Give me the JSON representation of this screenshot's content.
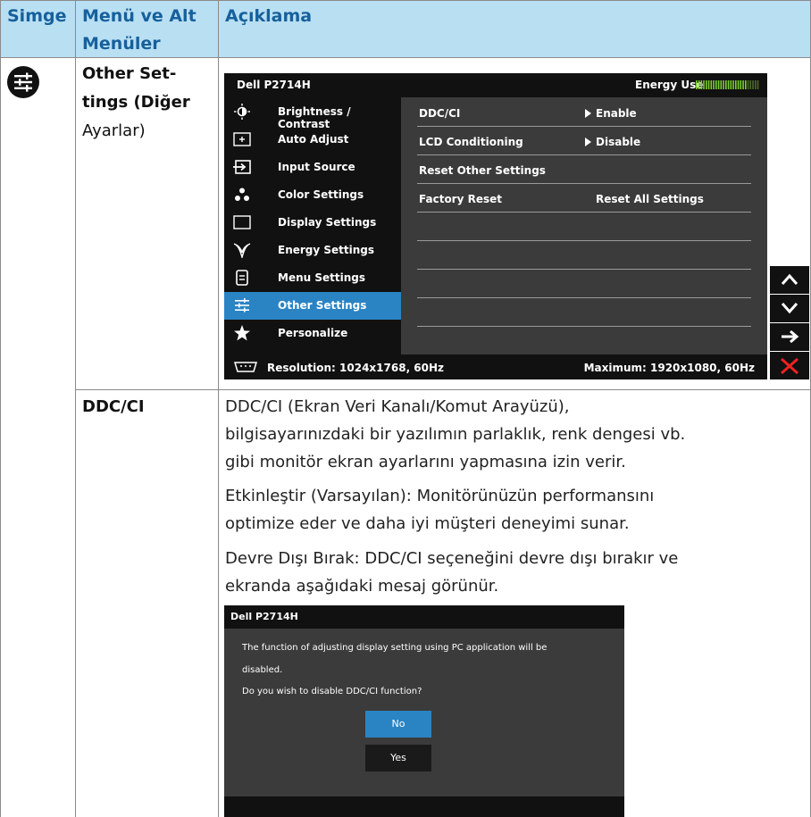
{
  "table": {
    "headers": [
      "Simge",
      "Menü ve Alt",
      "Menüler",
      "Açıklama"
    ],
    "row1": {
      "menu_lines": [
        "Other Set-",
        "tings (Diğer",
        "Ayarlar)"
      ]
    },
    "row2": {
      "menu": "DDC/CI",
      "paragraphs": [
        [
          "DDC/CI (Ekran Veri Kanalı/Komut Arayüzü),",
          "bilgisayarınızdaki bir yazılımın parlaklık, renk dengesi vb.",
          "gibi monitör ekran ayarlarını yapmasına izin verir."
        ],
        [
          "Etkinleştir (Varsayılan): Monitörünüzün performansını",
          "optimize eder ve daha iyi müşteri deneyimi sunar."
        ],
        [
          "Devre Dışı Bırak: DDC/CI seçeneğini devre dışı bırakır ve",
          "ekranda aşağıdaki mesaj görünür."
        ]
      ]
    }
  },
  "osd": {
    "title": "Dell P2714H",
    "energy_label": "Energy Use",
    "energy_level": 0.8,
    "menu": [
      {
        "label": "Brightness / Contrast",
        "icon": "brightness-icon"
      },
      {
        "label": "Auto Adjust",
        "icon": "auto-adjust-icon"
      },
      {
        "label": "Input Source",
        "icon": "input-source-icon"
      },
      {
        "label": "Color Settings",
        "icon": "color-settings-icon"
      },
      {
        "label": "Display Settings",
        "icon": "display-settings-icon"
      },
      {
        "label": "Energy Settings",
        "icon": "energy-settings-icon"
      },
      {
        "label": "Menu Settings",
        "icon": "menu-settings-icon"
      },
      {
        "label": "Other Settings",
        "icon": "other-settings-icon"
      },
      {
        "label": "Personalize",
        "icon": "star-icon"
      }
    ],
    "active_index": 7,
    "options": [
      {
        "name": "DDC/CI",
        "value": "Enable",
        "arrow": true
      },
      {
        "name": "LCD Conditioning",
        "value": "Disable",
        "arrow": true
      },
      {
        "name": "Reset Other Settings",
        "value": "",
        "arrow": false
      },
      {
        "name": "Factory Reset",
        "value": "Reset All Settings",
        "arrow": false
      }
    ],
    "resolution": "Resolution: 1024x1768, 60Hz",
    "maximum": "Maximum: 1920x1080, 60Hz",
    "nav_buttons": [
      "up-arrow-icon",
      "down-arrow-icon",
      "right-arrow-icon",
      "close-icon"
    ],
    "accent_color": "#2a84c4"
  },
  "dialog": {
    "title": "Dell P2714H",
    "lines": [
      "The function of adjusting display setting using PC application will be",
      "disabled.",
      "Do you wish to disable DDC/CI function?"
    ],
    "no_label": "No",
    "yes_label": "Yes"
  }
}
